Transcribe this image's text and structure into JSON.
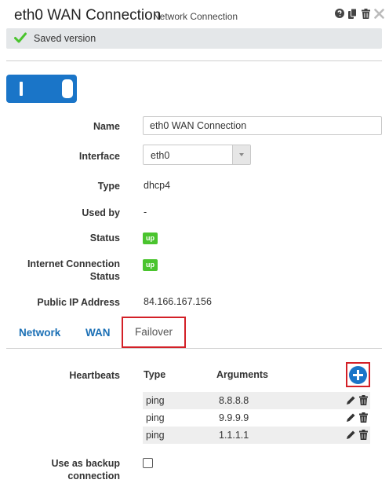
{
  "header": {
    "title": "eth0 WAN Connection",
    "subtitle": "Network Connection",
    "icons": [
      "help-icon",
      "copy-icon",
      "delete-icon",
      "close-icon"
    ]
  },
  "banner": {
    "text": "Saved version",
    "icon": "check-icon",
    "color": "#4ac42e"
  },
  "toggle": {
    "enabled": true,
    "color": "#1a75c8"
  },
  "fields": {
    "name": {
      "label": "Name",
      "value": "eth0 WAN Connection"
    },
    "interface": {
      "label": "Interface",
      "value": "eth0"
    },
    "type": {
      "label": "Type",
      "value": "dhcp4"
    },
    "used_by": {
      "label": "Used by",
      "value": "-"
    },
    "status": {
      "label": "Status",
      "value": "up"
    },
    "internet_status": {
      "label_line1": "Internet Connection",
      "label_line2": "Status",
      "value": "up"
    },
    "public_ip": {
      "label": "Public IP Address",
      "value": "84.166.167.156"
    }
  },
  "tabs": [
    {
      "label": "Network",
      "active": false
    },
    {
      "label": "WAN",
      "active": false
    },
    {
      "label": "Failover",
      "active": true
    }
  ],
  "heartbeats": {
    "label": "Heartbeats",
    "columns": {
      "type": "Type",
      "arguments": "Arguments"
    },
    "rows": [
      {
        "type": "ping",
        "argument": "8.8.8.8"
      },
      {
        "type": "ping",
        "argument": "9.9.9.9"
      },
      {
        "type": "ping",
        "argument": "1.1.1.1"
      }
    ]
  },
  "backup": {
    "label_line1": "Use as backup",
    "label_line2": "connection",
    "checked": false
  },
  "colors": {
    "accent": "#1a75c8",
    "link": "#1a6fb5",
    "highlight": "#d32027",
    "status_up": "#4ac42e"
  }
}
